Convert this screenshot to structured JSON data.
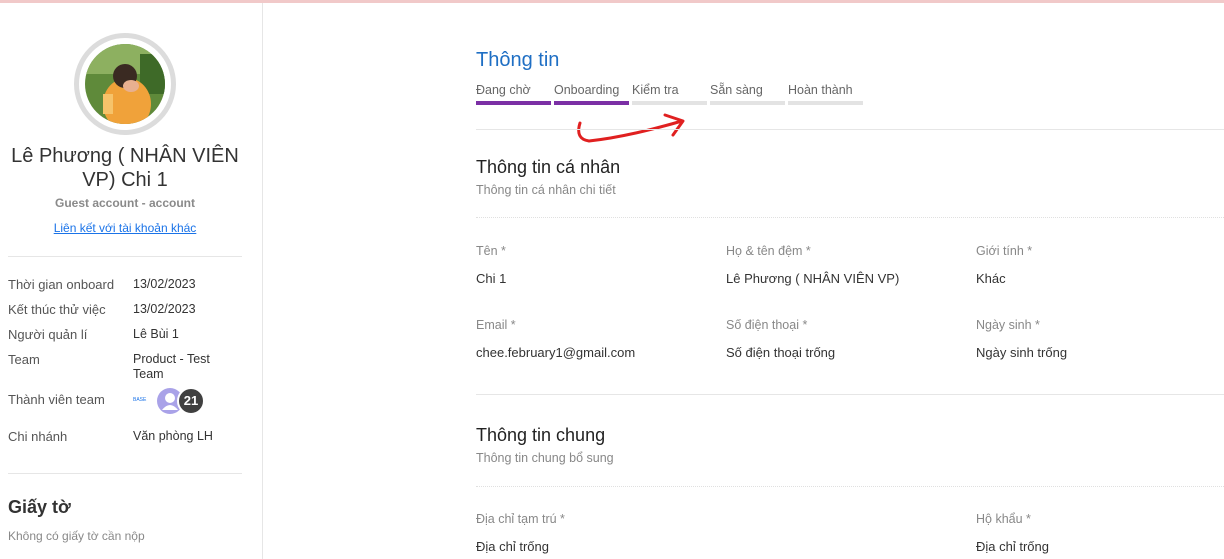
{
  "profile": {
    "name": "Lê Phương ( NHÂN VIÊN VP) Chi 1",
    "account_type": "Guest account - account",
    "link_other_account": "Liên kết với tài khoản khác",
    "details": [
      {
        "label": "Thời gian onboard",
        "value": "13/02/2023"
      },
      {
        "label": "Kết thúc thử việc",
        "value": "13/02/2023"
      },
      {
        "label": "Người quản lí",
        "value": "Lê Bùi 1"
      },
      {
        "label": "Team",
        "value": "Product - Test Team"
      },
      {
        "label": "Thành viên team",
        "value": ""
      },
      {
        "label": "Chi nhánh",
        "value": "Văn phòng LH"
      }
    ],
    "team_members": {
      "logo_text": "BASE",
      "count": "21"
    }
  },
  "documents": {
    "title": "Giấy tờ",
    "empty_text": "Không có giấy tờ cần nộp"
  },
  "main": {
    "title": "Thông tin",
    "steps": [
      {
        "label": "Đang chờ",
        "done": true
      },
      {
        "label": "Onboarding",
        "done": true
      },
      {
        "label": "Kiểm tra",
        "done": false
      },
      {
        "label": "Sẵn sàng",
        "done": false
      },
      {
        "label": "Hoàn thành",
        "done": false
      }
    ],
    "annotation_color": "#e02020",
    "personal": {
      "title": "Thông tin cá nhân",
      "subtitle": "Thông tin cá nhân chi tiết",
      "fields": [
        {
          "label": "Tên *",
          "value": "Chi 1"
        },
        {
          "label": "Họ & tên đệm *",
          "value": "Lê Phương ( NHÂN VIÊN VP)"
        },
        {
          "label": "Giới tính *",
          "value": "Khác"
        },
        {
          "label": "Email *",
          "value": "chee.february1@gmail.com"
        },
        {
          "label": "Số điện thoại *",
          "value": "Số điện thoại trống"
        },
        {
          "label": "Ngày sinh *",
          "value": "Ngày sinh trống"
        }
      ]
    },
    "general": {
      "title": "Thông tin chung",
      "subtitle": "Thông tin chung bổ sung",
      "fields": [
        {
          "label": "Địa chỉ tạm trú *",
          "value": "Địa chỉ trống"
        },
        {
          "label": "Hộ khẩu *",
          "value": "Địa chỉ trống"
        }
      ]
    }
  },
  "colors": {
    "accent": "#1f6fc4",
    "step_done": "#7b2fa5",
    "step_todo": "#e3e3e3",
    "link": "#1a73e8"
  }
}
